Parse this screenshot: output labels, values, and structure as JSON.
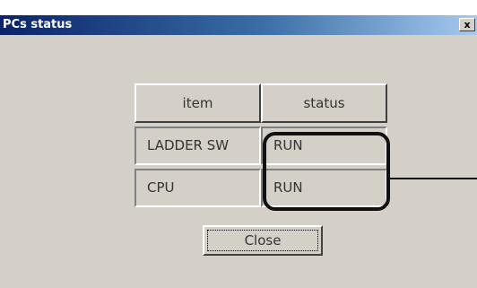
{
  "window": {
    "title": "PCs status",
    "close_glyph": "x"
  },
  "table": {
    "headers": [
      "item",
      "status"
    ],
    "rows": [
      {
        "item": "LADDER SW",
        "status": "RUN"
      },
      {
        "item": "CPU",
        "status": "RUN"
      }
    ]
  },
  "close_button": {
    "label": "Close"
  }
}
